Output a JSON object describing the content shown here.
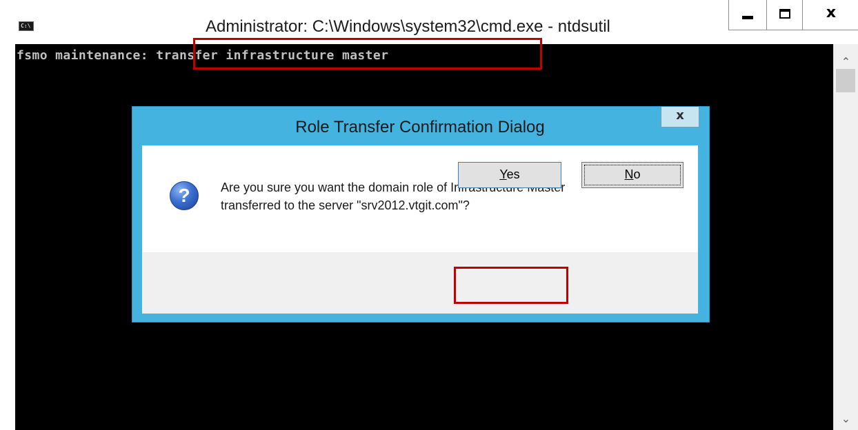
{
  "window": {
    "title": "Administrator: C:\\Windows\\system32\\cmd.exe - ntdsutil",
    "icon": "C:\\",
    "icon_name": "command-prompt-icon"
  },
  "console": {
    "prompt": "fsmo maintenance: ",
    "command": "transfer infrastructure master"
  },
  "dialog": {
    "title": "Role Transfer Confirmation Dialog",
    "close": "x",
    "message_line1": "Are you sure you want the domain role of Infrastructure Master",
    "message_line2": "transferred to the server \"srv2012.vtgit.com\"?",
    "icon_name": "question-icon",
    "yes": {
      "accel": "Y",
      "rest": "es"
    },
    "no": {
      "accel": "N",
      "rest": "o"
    }
  },
  "colors": {
    "dialog_border": "#45b3e0",
    "highlight": "#c00000",
    "console_bg": "#000000"
  }
}
